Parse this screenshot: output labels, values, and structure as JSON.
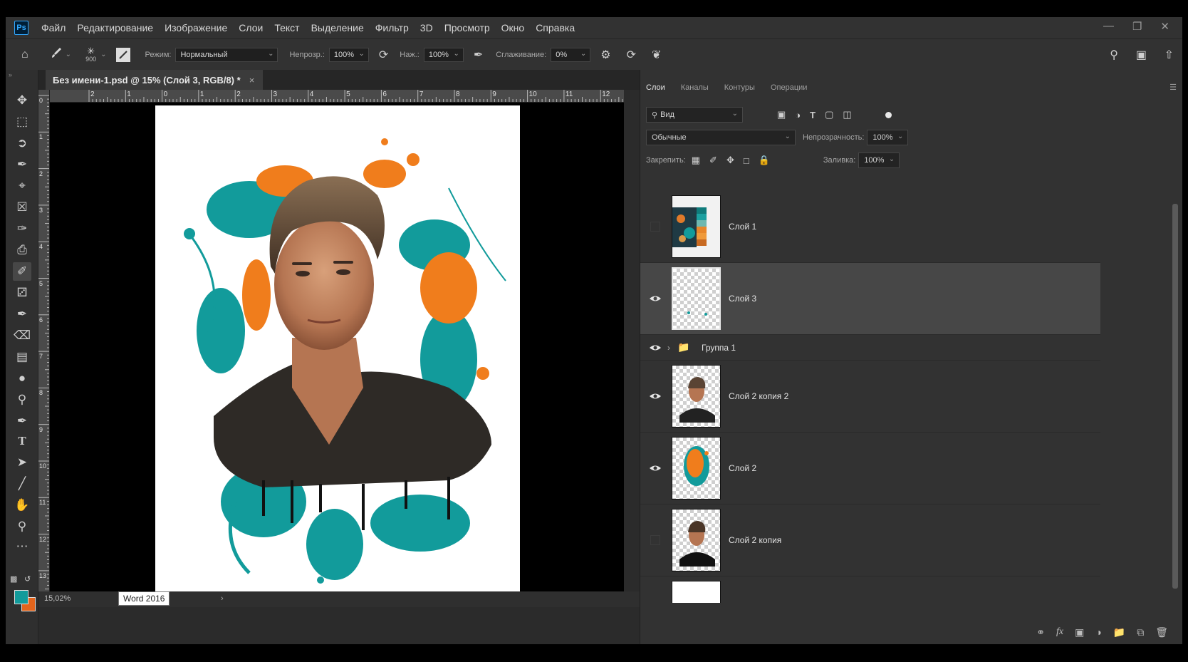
{
  "app": {
    "logo": "Ps",
    "menu": [
      "Файл",
      "Редактирование",
      "Изображение",
      "Слои",
      "Текст",
      "Выделение",
      "Фильтр",
      "3D",
      "Просмотр",
      "Окно",
      "Справка"
    ]
  },
  "options": {
    "brush_size": "900",
    "mode_label": "Режим:",
    "mode_value": "Нормальный",
    "opacity_label": "Непрозр.:",
    "opacity_value": "100%",
    "flow_label": "Наж.:",
    "flow_value": "100%",
    "smoothing_label": "Сглаживание:",
    "smoothing_value": "0%"
  },
  "document": {
    "tab_title": "Без имени-1.psd @ 15% (Слой 3, RGB/8) *",
    "zoom": "15,02%",
    "tooltip": "Word 2016",
    "ruler_top": [
      "2",
      "1",
      "0",
      "1",
      "2",
      "3",
      "4",
      "5",
      "6",
      "7",
      "8",
      "9",
      "10",
      "11",
      "12"
    ],
    "ruler_left": [
      "0",
      "1",
      "2",
      "3",
      "4",
      "5",
      "6",
      "7",
      "8",
      "9",
      "10",
      "11",
      "12",
      "13"
    ]
  },
  "colors": {
    "foreground": "#129b9b",
    "background": "#e2641c",
    "accent_teal": "#129b9b",
    "accent_orange": "#f07d1c"
  },
  "panel": {
    "tabs": [
      "Слои",
      "Каналы",
      "Контуры",
      "Операции"
    ],
    "filter_label": "Вид",
    "blend_value": "Обычные",
    "opacity_label": "Непрозрачность:",
    "opacity_value": "100%",
    "lock_label": "Закрепить:",
    "fill_label": "Заливка:",
    "fill_value": "100%"
  },
  "layers": [
    {
      "name": "Слой 1",
      "visible": false,
      "selected": false,
      "type": "layer"
    },
    {
      "name": "Слой 3",
      "visible": true,
      "selected": true,
      "type": "layer"
    },
    {
      "name": "Группа 1",
      "visible": true,
      "selected": false,
      "type": "group"
    },
    {
      "name": "Слой 2 копия 2",
      "visible": true,
      "selected": false,
      "type": "layer"
    },
    {
      "name": "Слой 2",
      "visible": true,
      "selected": false,
      "type": "layer"
    },
    {
      "name": "Слой 2 копия",
      "visible": false,
      "selected": false,
      "type": "layer"
    }
  ]
}
